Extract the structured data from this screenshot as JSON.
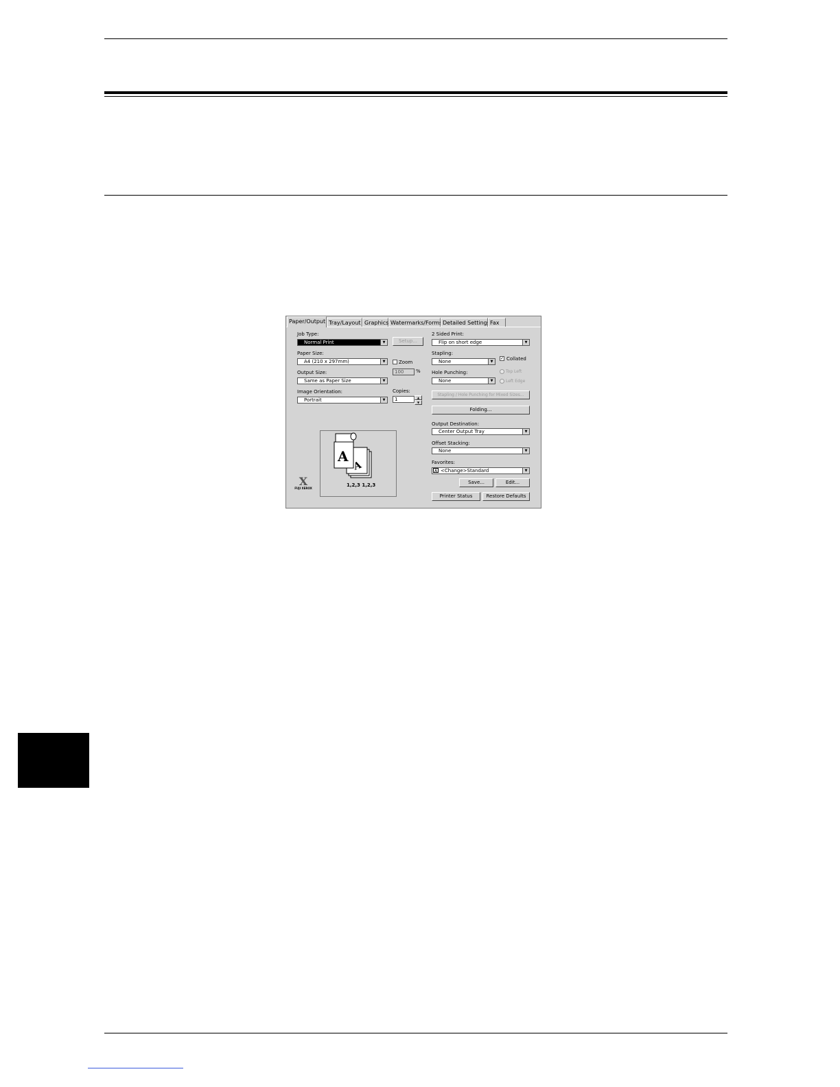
{
  "dialog": {
    "tabs": [
      "Paper/Output",
      "Tray/Layout",
      "Graphics",
      "Watermarks/Forms",
      "Detailed Settings",
      "Fax"
    ],
    "job_type": {
      "label": "Job Type:",
      "value": "Normal Print",
      "setup_button": "Setup..."
    },
    "paper_size": {
      "label": "Paper Size:",
      "value": "A4 (210 x 297mm)"
    },
    "zoom": {
      "label": "Zoom",
      "value": "100",
      "unit": "%"
    },
    "output_size": {
      "label": "Output Size:",
      "value": "Same as Paper Size"
    },
    "image_orientation": {
      "label": "Image Orientation:",
      "value": "Portrait"
    },
    "copies": {
      "label": "Copies:",
      "value": "1"
    },
    "two_sided": {
      "label": "2 Sided Print:",
      "value": "Flip on short edge"
    },
    "stapling": {
      "label": "Stapling:",
      "value": "None"
    },
    "collated": {
      "label": "Collated",
      "checked": true
    },
    "hole_punching": {
      "label": "Hole Punching:",
      "value": "None"
    },
    "radio_a": "Top Left",
    "radio_b": "Left Edge",
    "mixed_sizes_button": "Stapling / Hole Punching for Mixed Sizes...",
    "folding_button": "Folding...",
    "output_destination": {
      "label": "Output Destination:",
      "value": "Center Output Tray"
    },
    "offset_stacking": {
      "label": "Offset Stacking:",
      "value": "None"
    },
    "favorites": {
      "label": "Favorites:",
      "value": "<Change>Standard",
      "icon_letter": "A"
    },
    "save_button": "Save...",
    "edit_button": "Edit...",
    "printer_status_button": "Printer Status",
    "restore_defaults_button": "Restore Defaults",
    "preview": {
      "letter": "A",
      "collate_label": "1,2,3 1,2,3"
    },
    "logo": {
      "mark": "X",
      "text": "FUJI XEROX"
    }
  }
}
